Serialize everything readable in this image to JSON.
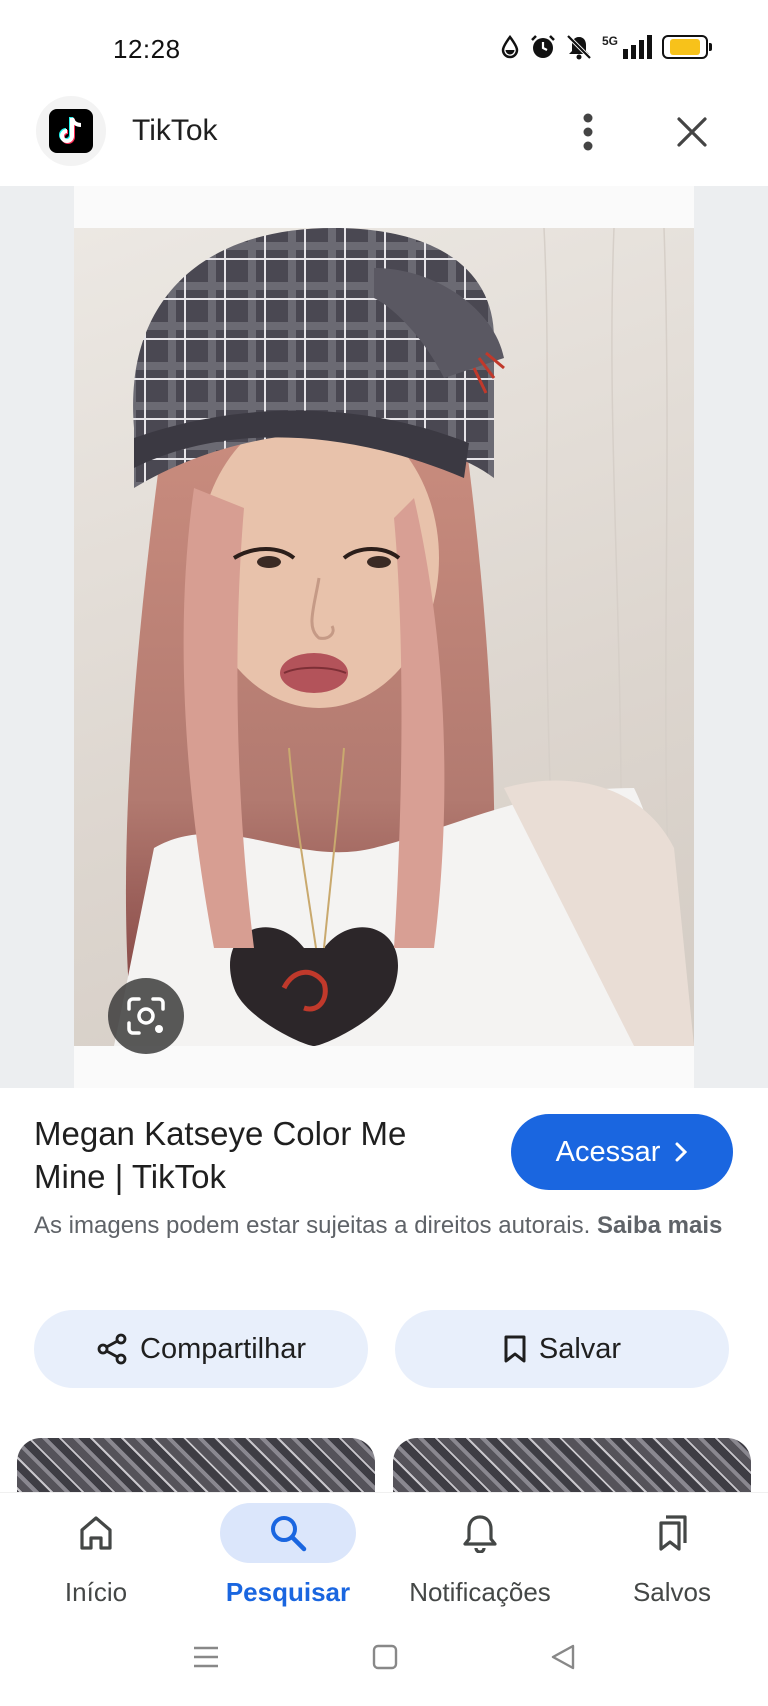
{
  "status_bar": {
    "time": "12:28",
    "network": "5G",
    "icons": [
      "water-drop-icon",
      "alarm-icon",
      "mute-icon",
      "signal-icon",
      "battery-icon"
    ],
    "battery_color": "#f7c21a"
  },
  "app_bar": {
    "site_name": "TikTok",
    "logo_icon": "tiktok-logo"
  },
  "image": {
    "description_icon": "lens-icon"
  },
  "result": {
    "title": "Megan Katseye Color Me Mine | TikTok",
    "visit_label": "Acessar",
    "copyright_text": "As imagens podem estar sujeitas a direitos autorais.",
    "copyright_link": "Saiba mais"
  },
  "actions": {
    "share_label": "Compartilhar",
    "save_label": "Salvar"
  },
  "bottom_nav": {
    "items": [
      {
        "label": "Início",
        "icon": "home-icon",
        "active": false
      },
      {
        "label": "Pesquisar",
        "icon": "search-icon",
        "active": true
      },
      {
        "label": "Notificações",
        "icon": "bell-icon",
        "active": false
      },
      {
        "label": "Salvos",
        "icon": "bookmarks-icon",
        "active": false
      }
    ]
  },
  "colors": {
    "accent": "#1a66e0",
    "chip_bg": "#e8effb",
    "active_nav_bg": "#dbe6fb"
  }
}
